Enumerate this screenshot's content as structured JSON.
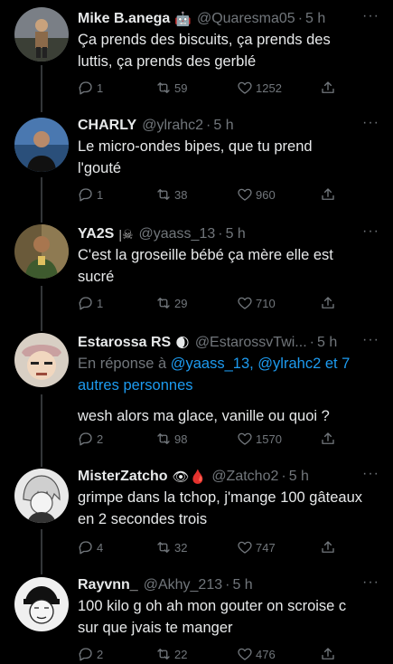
{
  "tweets": [
    {
      "name": "Mike B.anega",
      "emoji": "🤖",
      "handle": "@Quaresma05",
      "dot": "·",
      "time": "5 h",
      "more": "···",
      "text_lines": [
        "Ça prends des biscuits, ça prends des",
        "luttis, ça prends des gerblé"
      ],
      "replies": "1",
      "retweets": "59",
      "likes": "1252"
    },
    {
      "name": "CHARLY",
      "emoji": "",
      "handle": "@ylrahc2",
      "dot": "·",
      "time": "5 h",
      "more": "···",
      "text_lines": [
        "Le micro-ondes bipes, que tu prend",
        "l'gouté"
      ],
      "replies": "1",
      "retweets": "38",
      "likes": "960"
    },
    {
      "name": "YA2S",
      "emoji": "|☠",
      "handle": "@yaass_13",
      "dot": "·",
      "time": "5 h",
      "more": "···",
      "text_lines": [
        "C'est la groseille bébé ça mère elle est",
        "sucré"
      ],
      "replies": "1",
      "retweets": "29",
      "likes": "710"
    },
    {
      "name": "Estarossa RS",
      "emoji": "🌒",
      "handle": "@EstarossvTwi...",
      "dot": "·",
      "time": "5 h",
      "more": "···",
      "reply_prefix": "En réponse à ",
      "reply_link_1": "@yaass_13, @ylrahc2 et 7",
      "reply_link_2": "autres personnes",
      "text_lines": [
        "wesh alors ma glace, vanille ou quoi ?"
      ],
      "replies": "2",
      "retweets": "98",
      "likes": "1570"
    },
    {
      "name": "MisterZatcho",
      "emoji": "👁🩸",
      "handle": "@Zatcho2",
      "dot": "·",
      "time": "5 h",
      "more": "···",
      "text_lines": [
        "grimpe dans la tchop, j'mange 100 gâteaux",
        "en 2 secondes trois"
      ],
      "replies": "4",
      "retweets": "32",
      "likes": "747"
    },
    {
      "name": "Rayvnn_",
      "emoji": "",
      "handle": "@Akhy_213",
      "dot": "·",
      "time": "5 h",
      "more": "···",
      "text_lines": [
        "100 kilo g oh ah mon gouter on scroise c",
        "sur que jvais te manger"
      ],
      "replies": "2",
      "retweets": "22",
      "likes": "476"
    }
  ]
}
